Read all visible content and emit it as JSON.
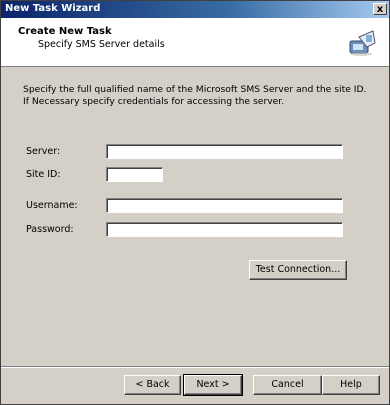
{
  "window": {
    "title": "New Task Wizard",
    "close_glyph": "x"
  },
  "header": {
    "title": "Create New Task",
    "subtitle": "Specify SMS Server details",
    "icon": "computer-wizard-icon"
  },
  "content": {
    "description": "Specify the full qualified name of the Microsoft SMS Server and the site ID. If Necessary specify credentials for accessing the server.",
    "server_label": "Server:",
    "server_value": "",
    "site_id_label": "Site ID:",
    "site_id_value": "",
    "username_label": "Username:",
    "username_value": "",
    "password_label": "Password:",
    "password_value": "",
    "test_connection_label": "Test Connection..."
  },
  "footer": {
    "back_label": "< Back",
    "next_label": "Next >",
    "cancel_label": "Cancel",
    "help_label": "Help"
  }
}
